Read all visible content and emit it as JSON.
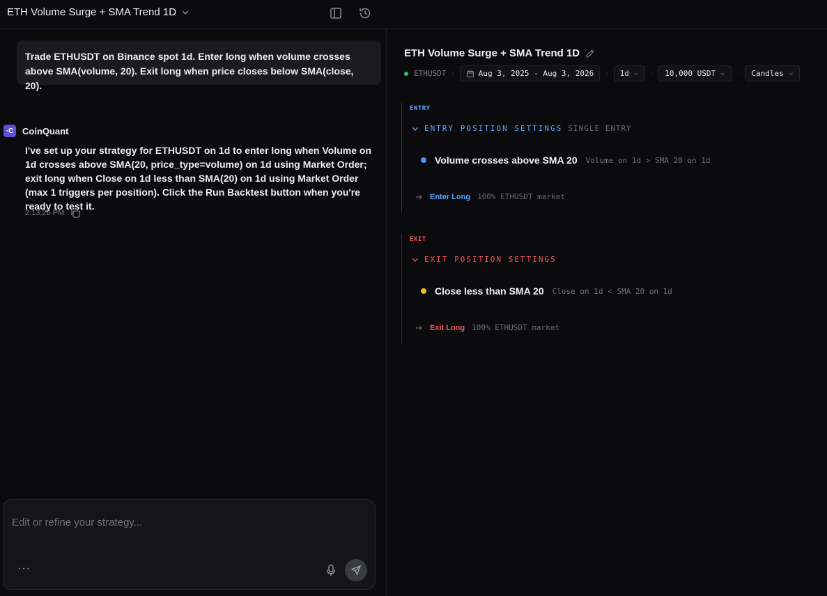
{
  "header": {
    "title": "ETH Volume Surge + SMA Trend 1D",
    "icons": [
      "chevron-down-icon",
      "sidebar-toggle-icon",
      "history-icon"
    ]
  },
  "chat": {
    "user_message": "Trade ETHUSDT on Binance spot 1d. Enter long when volume crosses above SMA(volume, 20). Exit long when price closes below SMA(close, 20).",
    "bot": {
      "avatar_text": "·C",
      "name": "CoinQuant",
      "message": "I've set up your strategy for ETHUSDT on 1d to enter long when Volume on 1d crosses above SMA(20, price_type=volume) on 1d using Market Order; exit long when Close on 1d less than SMA(20) on 1d using Market Order (max 1 triggers per position). Click the Run Backtest button when you're ready to test it.",
      "timestamp": "2:13:26 PM"
    },
    "composer": {
      "placeholder": "Edit or refine your strategy...",
      "value": "",
      "more_label": "···"
    }
  },
  "strategy": {
    "title": "ETH Volume Surge + SMA Trend 1D",
    "symbol": "ETHUSDT",
    "date_range": "Aug 3, 2025 - Aug 3, 2026",
    "timeframe": "1d",
    "capital": "10,000 USDT",
    "chart_type": "Candles",
    "separator": "·",
    "entry": {
      "label": "ENTRY",
      "header": "ENTRY POSITION SETTINGS",
      "subheader": "SINGLE ENTRY",
      "condition_title": "Volume crosses above SMA 20",
      "condition_detail": "Volume on 1d > SMA 20 on 1d",
      "action_label": "Enter Long",
      "action_detail": "100% ETHUSDT market"
    },
    "exit": {
      "label": "EXIT",
      "header": "EXIT POSITION SETTINGS",
      "condition_title": "Close less than SMA 20",
      "condition_detail": "Close on 1d < SMA 20 on 1d",
      "action_label": "Exit Long",
      "action_detail": "100% ETHUSDT market"
    }
  },
  "colors": {
    "background": "#0b0b0e",
    "entry_accent": "#5aa2ff",
    "exit_accent": "#f2545b",
    "entry_dot": "#4f95f5",
    "exit_dot": "#f5b81d",
    "live_dot": "#22c55e",
    "brand": "#5b50d6"
  }
}
